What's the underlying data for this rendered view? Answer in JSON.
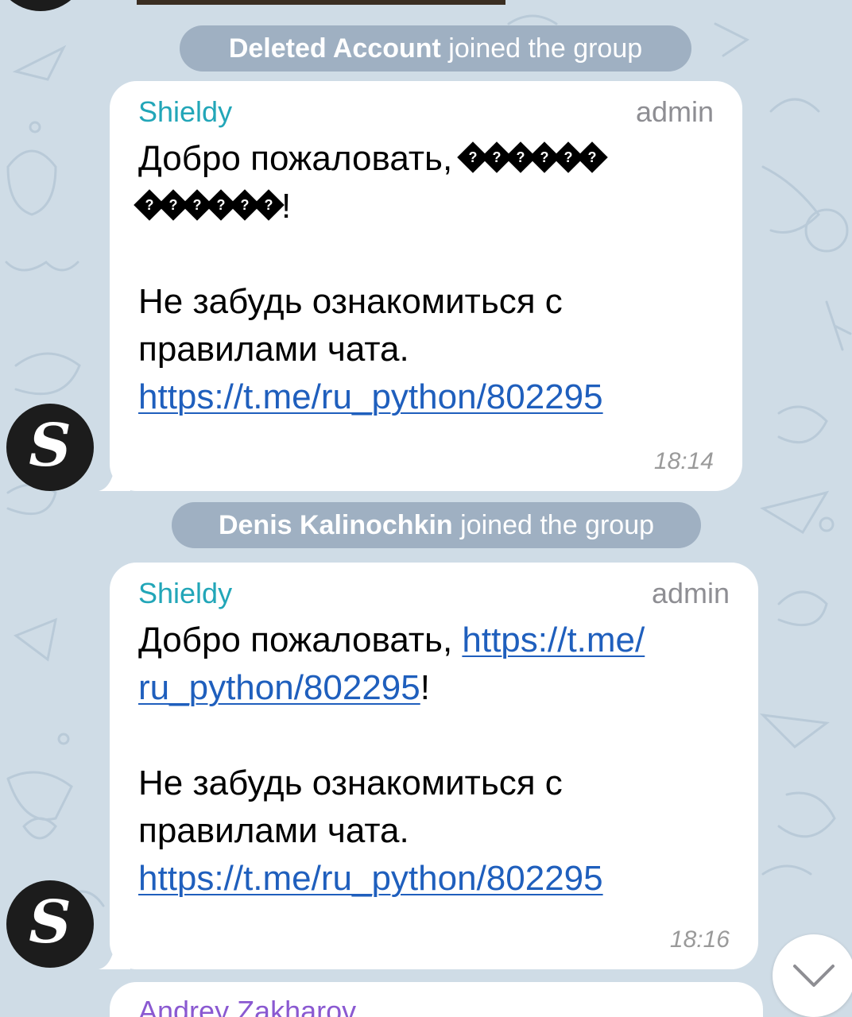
{
  "service_messages": [
    {
      "name": "Deleted Account",
      "action": "joined the group"
    },
    {
      "name": "Denis Kalinochkin",
      "action": "joined the group"
    }
  ],
  "messages": [
    {
      "sender": "Shieldy",
      "role": "admin",
      "greeting": "Добро пожаловать, ",
      "garbled_group1": "������",
      "garbled_group2": "������",
      "exclaim": "!",
      "reminder_line1": "Не забудь ознакомиться с",
      "reminder_line2": "правилами чата.",
      "link": "https://t.me/ru_python/802295",
      "time": "18:14",
      "avatar_letter": "S"
    },
    {
      "sender": "Shieldy",
      "role": "admin",
      "greeting": "Добро пожаловать, ",
      "greeting_link_part1": "https://t.me/",
      "greeting_link_part2": "ru_python/802295",
      "exclaim": "!",
      "reminder_line1": "Не забудь ознакомиться с",
      "reminder_line2": "правилами чата.",
      "link": "https://t.me/ru_python/802295",
      "time": "18:16",
      "avatar_letter": "S"
    }
  ],
  "next_message": {
    "sender": "Andrey Zakharov"
  },
  "colors": {
    "background": "#cfdce6",
    "sender": "#22a6b8",
    "link": "#1f5fbd",
    "next_sender": "#8a59d1"
  },
  "icons": {
    "scroll_down": "chevron-down-icon"
  }
}
